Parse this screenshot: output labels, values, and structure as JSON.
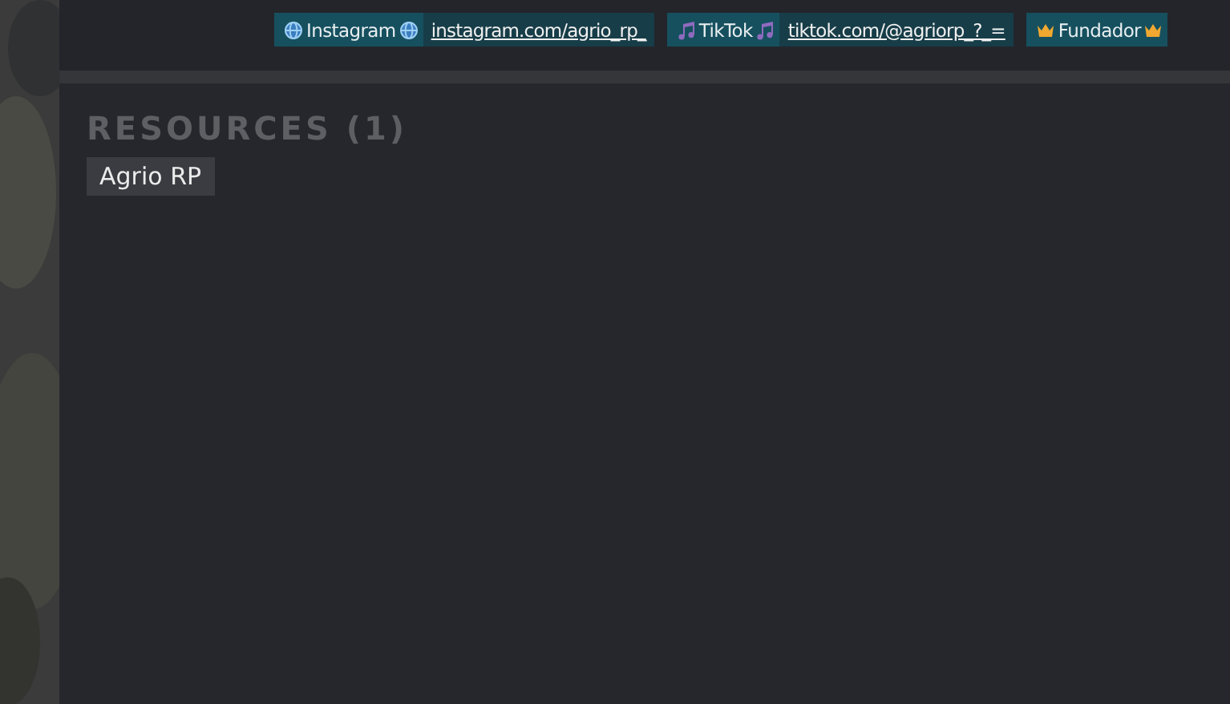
{
  "social_tags": [
    {
      "kind": "globe",
      "label": "Instagram",
      "value": "instagram.com/agrio_rp_"
    },
    {
      "kind": "music",
      "label": "TikTok",
      "value": "tiktok.com/@agriorp_?_="
    },
    {
      "kind": "crown",
      "label": "Fundador"
    }
  ],
  "resources": {
    "heading": "RESOURCES (1)",
    "items": [
      "Agrio RP"
    ]
  }
}
